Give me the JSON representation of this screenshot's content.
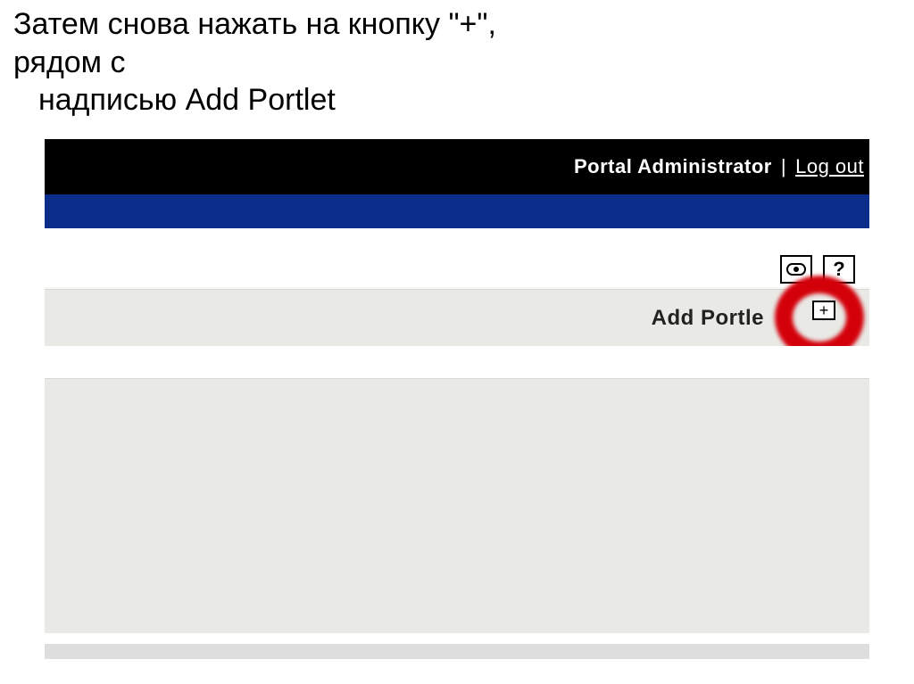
{
  "instruction": {
    "line1": "Затем снова нажать на кнопку \"+\", рядом с",
    "line2": "надписью Add Portlet"
  },
  "header": {
    "title": "Portal Administrator",
    "separator": "|",
    "logout": "Log out"
  },
  "toolbar": {
    "help_label": "?"
  },
  "addportlet": {
    "label": "Add Portle",
    "plus": "+"
  }
}
